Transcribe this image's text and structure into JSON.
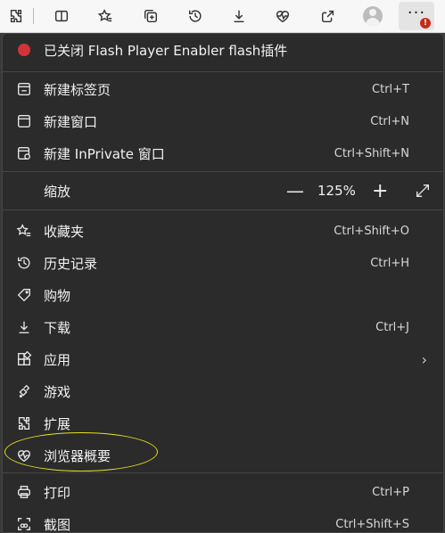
{
  "toolbar": {
    "icons": [
      "extensions-icon",
      "split-screen-icon",
      "favorites-icon",
      "collections-icon",
      "history-icon",
      "downloads-icon",
      "browser-essentials-icon",
      "share-icon",
      "profile-avatar",
      "more-icon"
    ],
    "more_badge": "!"
  },
  "menu": {
    "notice": {
      "label": "已关闭 Flash Player Enabler flash插件",
      "color": "#d13438"
    },
    "items": [
      {
        "label": "新建标签页",
        "shortcut": "Ctrl+T"
      },
      {
        "label": "新建窗口",
        "shortcut": "Ctrl+N"
      },
      {
        "label": "新建 InPrivate 窗口",
        "shortcut": "Ctrl+Shift+N"
      }
    ],
    "zoom": {
      "label": "缩放",
      "minus": "—",
      "value": "125%",
      "plus": "+"
    },
    "items2": [
      {
        "label": "收藏夹",
        "shortcut": "Ctrl+Shift+O"
      },
      {
        "label": "历史记录",
        "shortcut": "Ctrl+H"
      },
      {
        "label": "购物",
        "shortcut": ""
      },
      {
        "label": "下载",
        "shortcut": "Ctrl+J"
      },
      {
        "label": "应用",
        "shortcut": "",
        "chevron": "›"
      },
      {
        "label": "游戏",
        "shortcut": ""
      },
      {
        "label": "扩展",
        "shortcut": ""
      },
      {
        "label": "浏览器概要",
        "shortcut": ""
      }
    ],
    "items3": [
      {
        "label": "打印",
        "shortcut": "Ctrl+P"
      },
      {
        "label": "截图",
        "shortcut": "Ctrl+Shift+S"
      }
    ]
  },
  "colors": {
    "highlight": "#e6e01f",
    "badge": "#c42b1c",
    "menu_bg": "#2b2b2b"
  }
}
